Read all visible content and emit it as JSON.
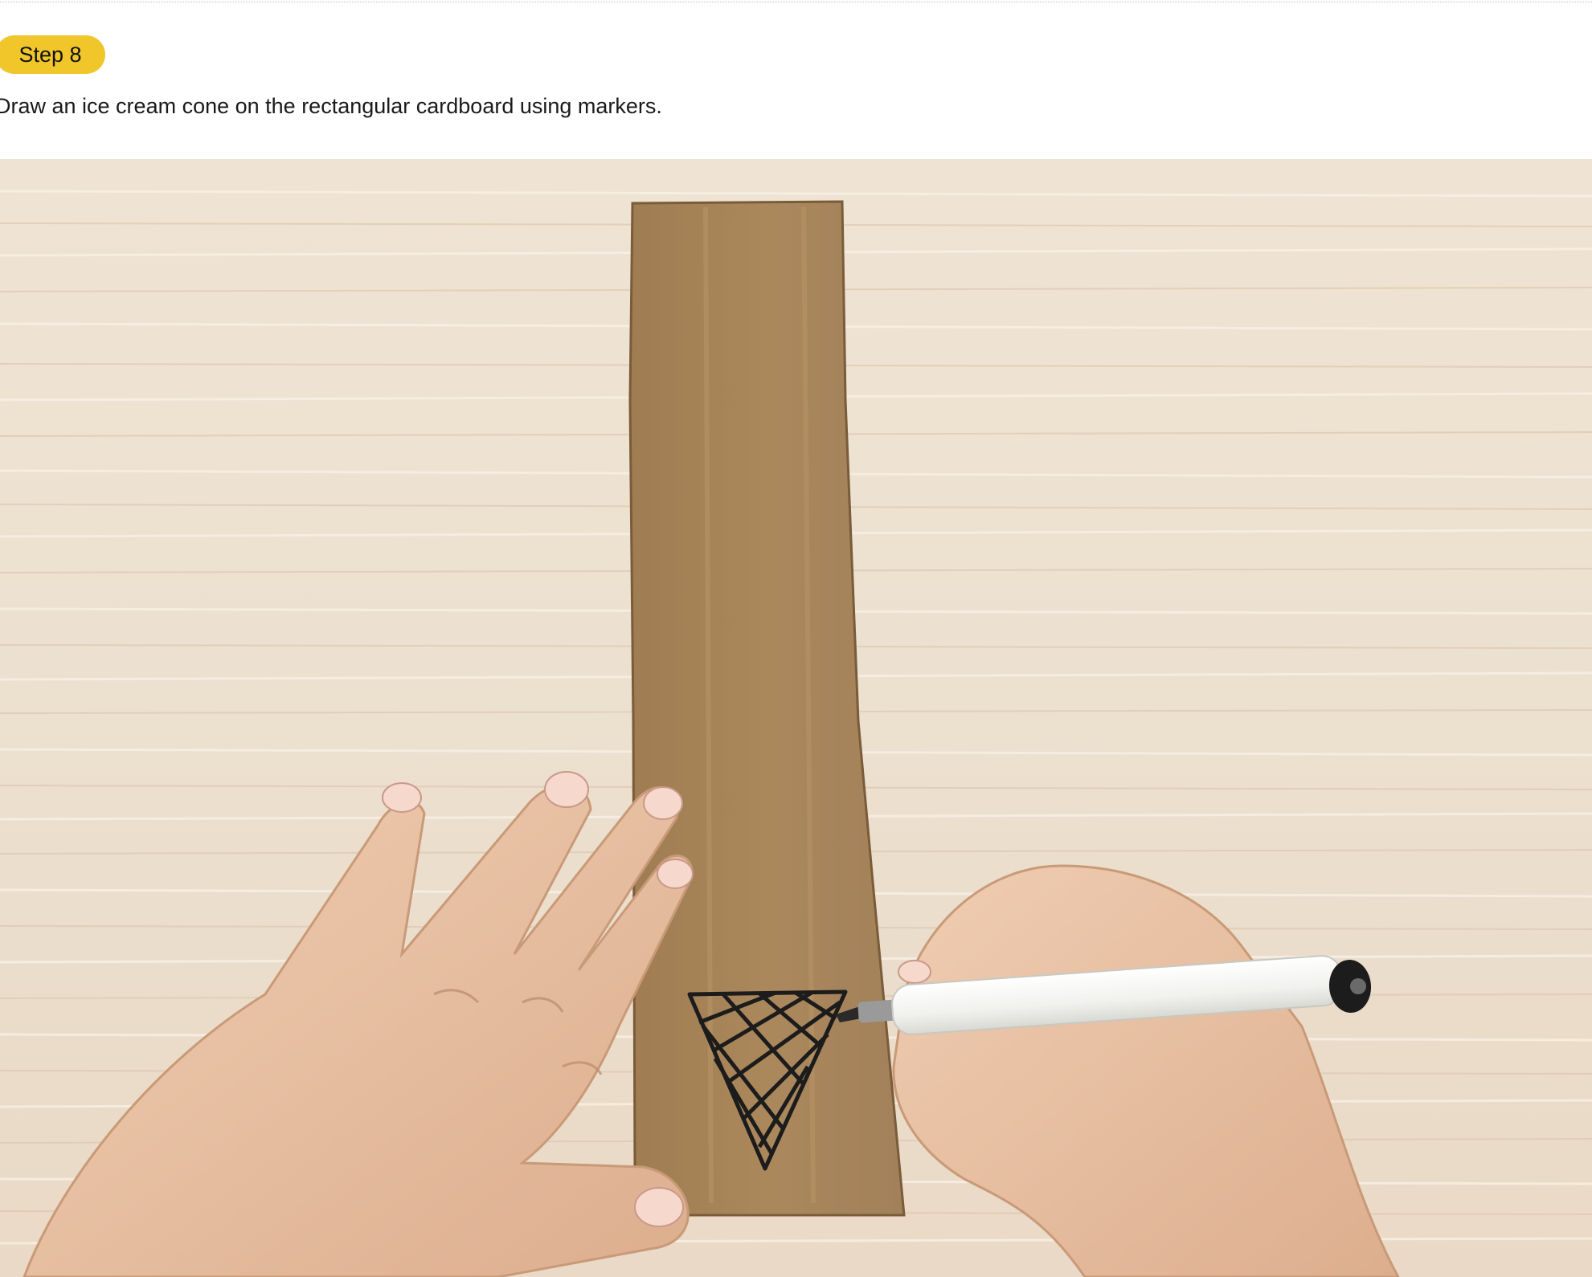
{
  "step": {
    "badge_label": "Step 8",
    "instruction": "Draw an ice cream cone on the rectangular cardboard using markers."
  },
  "photo": {
    "subject_icon": "hands-drawing-cone-photo",
    "colors": {
      "badge": "#f0c62b",
      "wood": "#efe2d2",
      "cardboard": "#a8855a",
      "skin": "#e9c3a6",
      "marker": "#f4f4f2",
      "ink": "#1c1c1c"
    }
  }
}
